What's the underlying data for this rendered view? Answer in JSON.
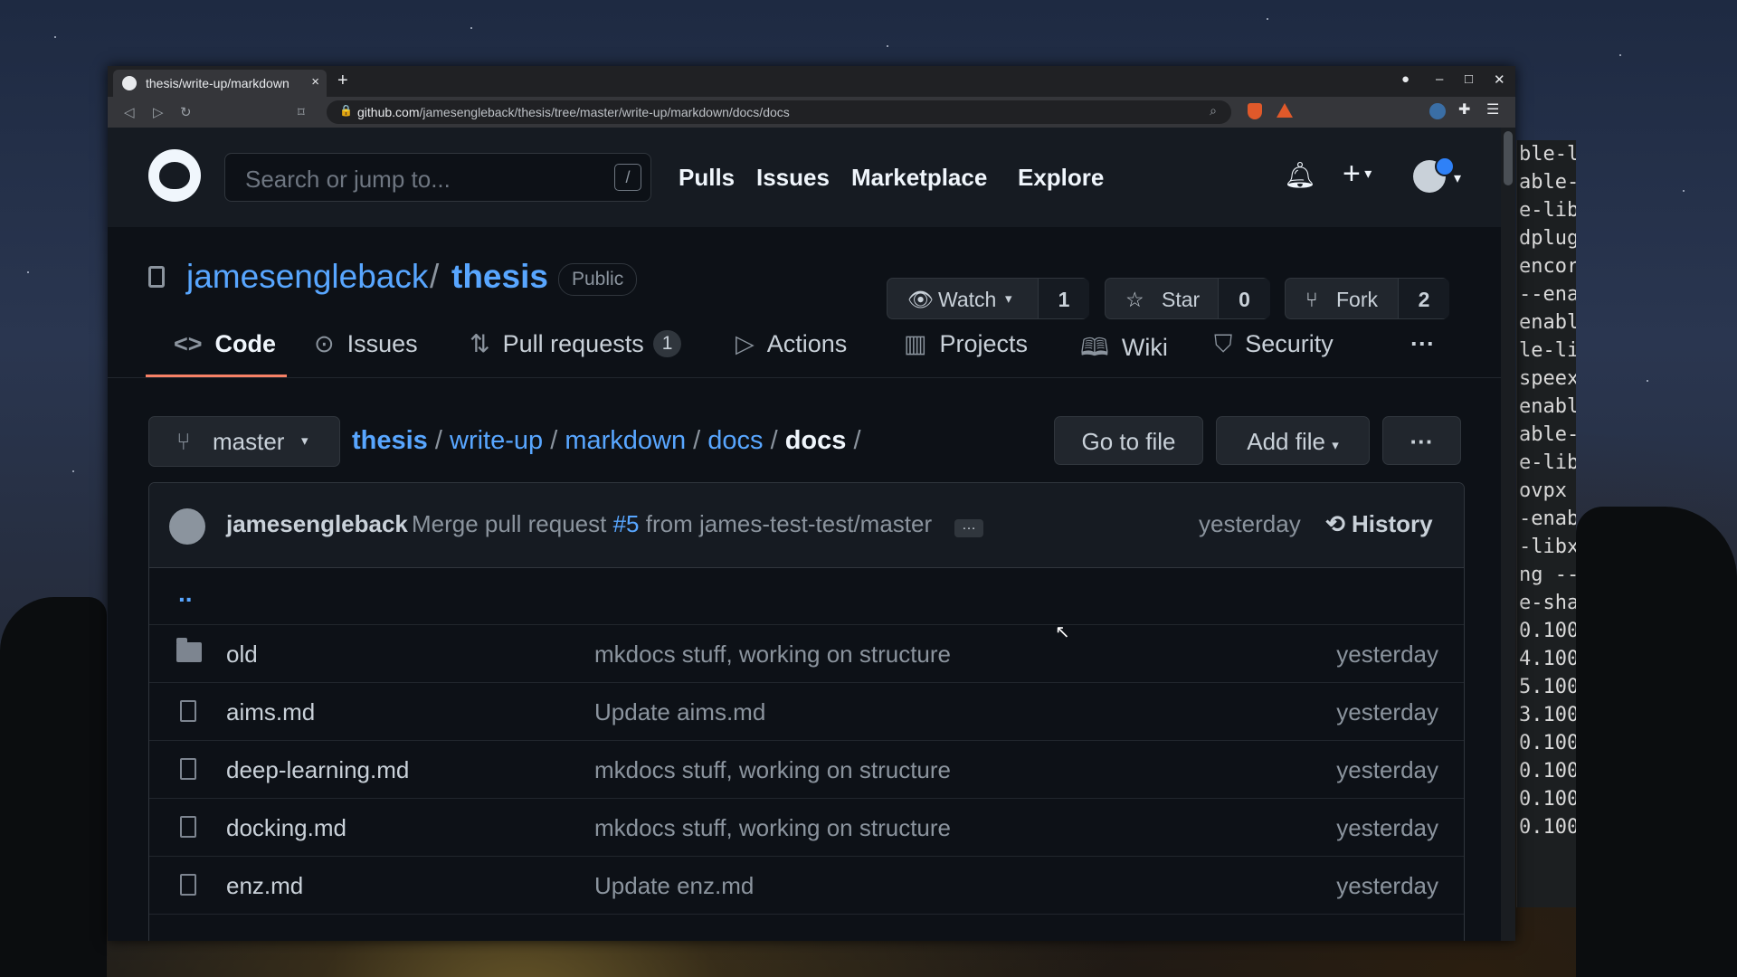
{
  "browser": {
    "tab_title": "thesis/write-up/markdown",
    "tab_close": "×",
    "new_tab": "+",
    "url_domain": "github.com",
    "url_path": "/jamesengleback/thesis/tree/master/write-up/markdown/docs/docs"
  },
  "header": {
    "search_placeholder": "Search or jump to...",
    "search_key": "/",
    "nav": [
      "Pulls",
      "Issues",
      "Marketplace",
      "Explore"
    ]
  },
  "repo": {
    "owner": "jamesengleback",
    "slash": "/",
    "name": "thesis",
    "visibility": "Public",
    "watch_label": "Watch",
    "watch_count": "1",
    "star_label": "Star",
    "star_count": "0",
    "fork_label": "Fork",
    "fork_count": "2"
  },
  "tabs": {
    "code": "Code",
    "issues": "Issues",
    "pulls": "Pull requests",
    "pulls_count": "1",
    "actions": "Actions",
    "projects": "Projects",
    "wiki": "Wiki",
    "security": "Security",
    "more": "···"
  },
  "nav_bar": {
    "branch": "master",
    "crumbs": [
      "thesis",
      "write-up",
      "markdown",
      "docs"
    ],
    "current": "docs",
    "go_to_file": "Go to file",
    "add_file": "Add file",
    "more": "···"
  },
  "commit": {
    "author": "jamesengleback",
    "message_prefix": "Merge pull request",
    "pr": "#5",
    "message_suffix": "from james-test-test/master",
    "ellipsis": "…",
    "when": "yesterday",
    "history": "History"
  },
  "updir": "..",
  "files": [
    {
      "name": "old",
      "type": "folder",
      "message": "mkdocs stuff, working on structure",
      "age": "yesterday"
    },
    {
      "name": "aims.md",
      "type": "file",
      "message": "Update aims.md",
      "age": "yesterday"
    },
    {
      "name": "deep-learning.md",
      "type": "file",
      "message": "mkdocs stuff, working on structure",
      "age": "yesterday"
    },
    {
      "name": "docking.md",
      "type": "file",
      "message": "mkdocs stuff, working on structure",
      "age": "yesterday"
    },
    {
      "name": "enz.md",
      "type": "file",
      "message": "Update enz.md",
      "age": "yesterday"
    }
  ],
  "terminal_lines": [
    "ble-l",
    "able-",
    "e-lib",
    "dplug",
    "encor",
    "--ena",
    "enabl",
    "le-li",
    "speex",
    "enabl",
    "able-",
    "e-lib",
    "ovpx",
    "-enab",
    "-libx",
    "ng --",
    "e-sha",
    "",
    "0.100",
    "4.100",
    "5.100",
    "3.100",
    "0.100",
    "0.100",
    "0.100",
    "0.100"
  ]
}
